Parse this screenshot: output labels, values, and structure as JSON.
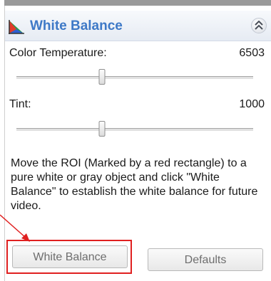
{
  "panel": {
    "title": "White Balance",
    "icons": {
      "header": "color-triangle-icon",
      "collapse": "double-chevron-up-icon"
    }
  },
  "color_temperature": {
    "label": "Color Temperature:",
    "value": "6503",
    "slider_position": 0.36
  },
  "tint": {
    "label": "Tint:",
    "value": "1000",
    "slider_position": 0.36
  },
  "description": "Move the ROI (Marked by a red rectangle) to a pure white or gray object and click \"White Balance\" to establish the white balance for future video.",
  "buttons": {
    "white_balance": "White Balance",
    "defaults": "Defaults"
  },
  "annotation": {
    "color": "#e02020"
  }
}
